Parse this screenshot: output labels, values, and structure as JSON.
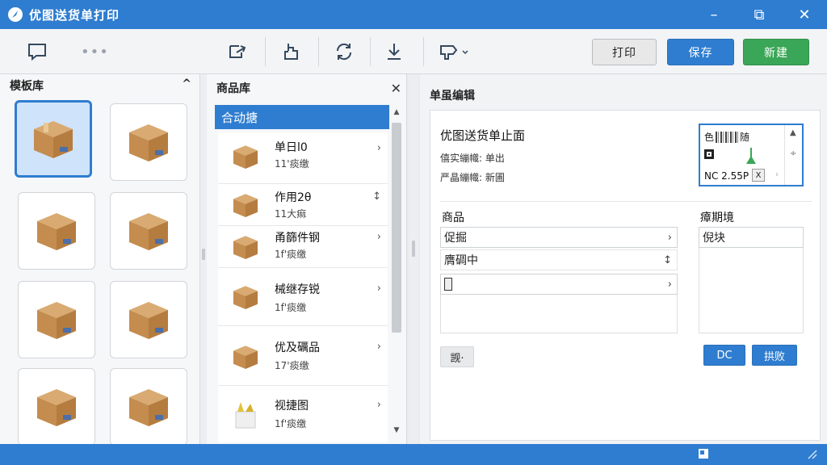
{
  "app": {
    "title": "优图送货单打印"
  },
  "window": {
    "minimize": "–",
    "restore": "⧉",
    "close": "✕"
  },
  "toolbar": {
    "dots": "•••",
    "print_label": "打印",
    "save_label": "保存",
    "new_label": "新建"
  },
  "templates": {
    "title": "模板库",
    "collapse": "^"
  },
  "products": {
    "title": "商品库",
    "close": "✕",
    "category": "合动搪",
    "items": [
      {
        "name": "单日l0",
        "sub": "11'痰缴",
        "arrow": "›"
      },
      {
        "name": "作用2θ",
        "sub": "11大痲",
        "arrow": "↕"
      },
      {
        "name": "甬篩件钢",
        "sub": "1f'痰缴",
        "arrow": "›"
      },
      {
        "name": "械继存锐",
        "sub": "1f'痰缴",
        "arrow": "›"
      },
      {
        "name": "优及礪品",
        "sub": "17'痰缴",
        "arrow": "›"
      },
      {
        "name": "视捷图",
        "sub": "1f'痰缴",
        "arrow": "›"
      }
    ]
  },
  "editor": {
    "title": "单虽编辑",
    "doc_title": "优图送货单止面",
    "meta1": "僖实繃幟: 单出",
    "meta2": "严晶繃幟: 新圃",
    "barcode": {
      "top_text": "色",
      "top_text2": "随",
      "code": "NC 2.55P",
      "x": "X",
      "side_up": "▲",
      "side_mid": "÷",
      "chev": "›"
    },
    "goods_label": "商品",
    "goods_rows": [
      {
        "text": "促掘",
        "icon": "›"
      },
      {
        "text": "膺碉中",
        "icon": "↕"
      },
      {
        "text": "",
        "icon": "›"
      }
    ],
    "side_label": "瘴期境",
    "side_value": "倪块",
    "bottom_btn": "觊·",
    "dc_btn": "DC",
    "confirm_btn": "拱败"
  }
}
